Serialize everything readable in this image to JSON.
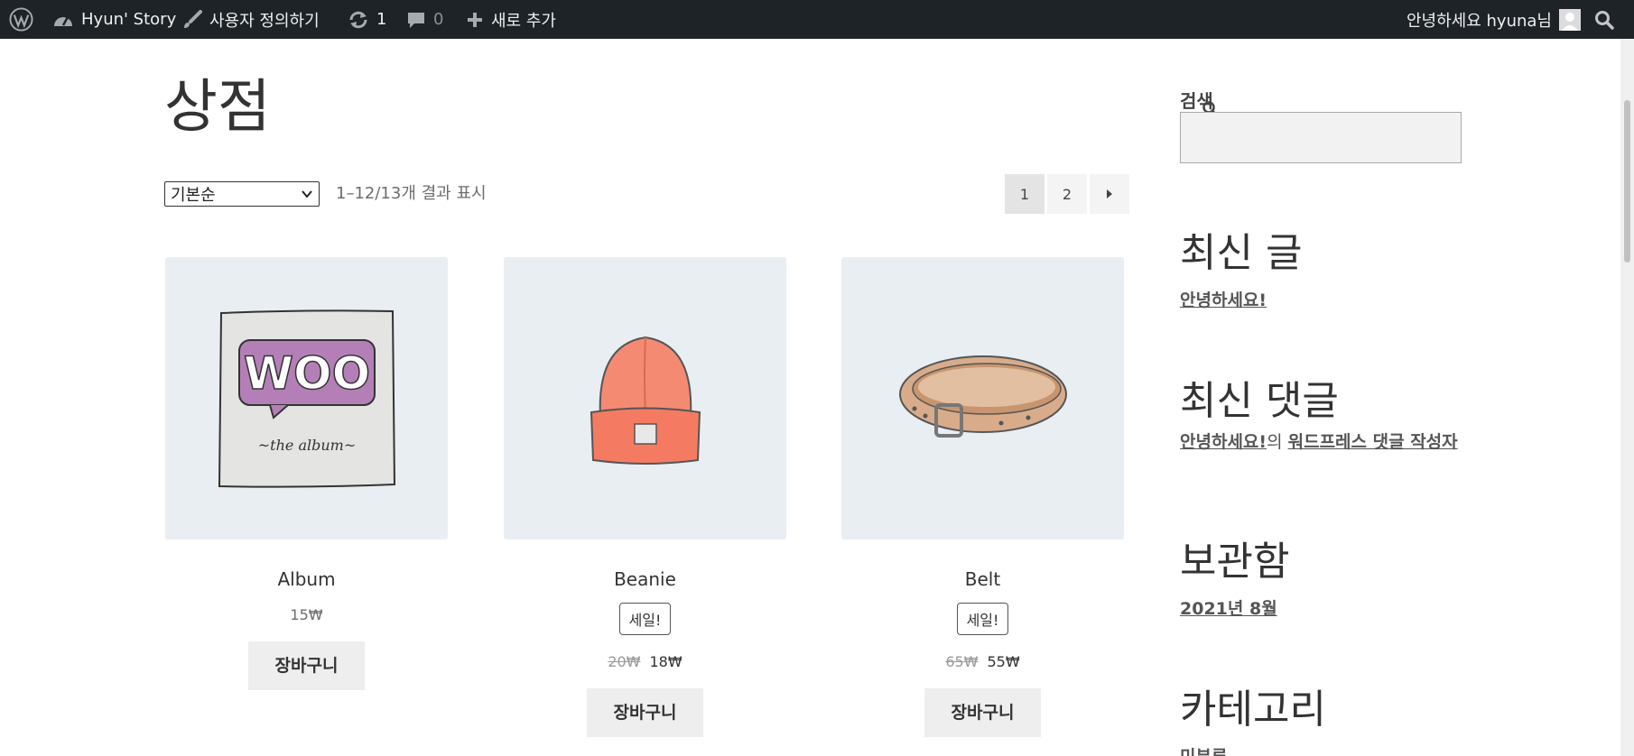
{
  "adminbar": {
    "site_name": "Hyun' Story",
    "customize": "사용자 정의하기",
    "updates_count": "1",
    "comments_count": "0",
    "new_label": "새로 추가",
    "greeting": "안녕하세요 hyuna님"
  },
  "page": {
    "title": "상점"
  },
  "toolbar": {
    "orderby_selected": "기본순",
    "result_count": "1–12/13개 결과 표시"
  },
  "pagination": {
    "pages": [
      "1",
      "2"
    ],
    "current": "1",
    "next_icon": "next-arrow-icon"
  },
  "products": [
    {
      "name": "Album",
      "price": "15₩",
      "cart_label": "장바구니"
    },
    {
      "name": "Beanie",
      "badge": "세일!",
      "old_price": "20₩",
      "price": "18₩",
      "cart_label": "장바구니"
    },
    {
      "name": "Belt",
      "badge": "세일!",
      "old_price": "65₩",
      "price": "55₩",
      "cart_label": "장바구니"
    }
  ],
  "sidebar": {
    "search_label": "검색",
    "recent_posts_title": "최신 글",
    "recent_post_1": "안녕하세요!",
    "recent_comments_title": "최신 댓글",
    "comment_post": "안녕하세요!",
    "comment_connector": "의",
    "comment_author": "워드프레스 댓글 작성자",
    "archives_title": "보관함",
    "archive_1": "2021년 8월",
    "categories_title": "카테고리",
    "category_1": "미분류"
  },
  "colors": {
    "adminbar_bg": "#1d2327",
    "product_bg": "#e8eef2",
    "button_bg": "#eeeeee"
  }
}
